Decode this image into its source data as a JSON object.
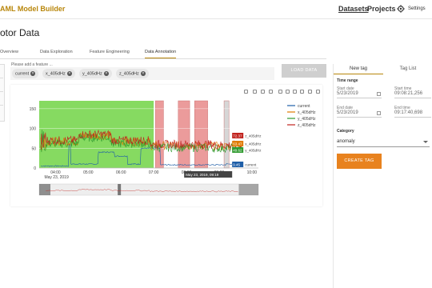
{
  "header": {
    "app_title": "AML Model Builder",
    "datasets": "Datasets",
    "projects": "Projects",
    "settings": "Settings"
  },
  "page_title": "otor Data",
  "tabs": [
    "Overview",
    "Data Exploration",
    "Feature Engineering",
    "Data Annotation"
  ],
  "active_tab": "Data Annotation",
  "feature_input": {
    "placeholder": "Please add a feature ...",
    "chips": [
      "current",
      "x_405dHz",
      "y_405dHz",
      "z_405dHz"
    ]
  },
  "load_button": "LOAD DATA",
  "right_panel": {
    "tabs": [
      "New tag",
      "Tag List"
    ],
    "time_range_label": "Time range",
    "start_date_label": "Start date",
    "start_date": "5/23/2019",
    "start_time_label": "Start time",
    "start_time": "09:08:21,256",
    "end_date_label": "End date",
    "end_date": "5/23/2019",
    "end_time_label": "End time",
    "end_time": "09:17:40,698",
    "category_label": "Category",
    "category_value": "anomaly",
    "create_button": "CREATE TAG"
  },
  "chart_data": {
    "type": "line",
    "x_ticks": [
      "04:00",
      "05:00",
      "06:00",
      "07:00",
      "08:00",
      "09:00",
      "10:00"
    ],
    "x_date_label": "May 23, 2019",
    "y_ticks": [
      0,
      50,
      100,
      150
    ],
    "ylim": [
      0,
      170
    ],
    "x_range_hours": [
      3.5,
      10.2
    ],
    "series": [
      {
        "name": "current",
        "color": "#1f5fa8"
      },
      {
        "name": "x_405dHz",
        "color": "#e07b00"
      },
      {
        "name": "y_405dHz",
        "color": "#2e9a2e"
      },
      {
        "name": "z_405dHz",
        "color": "#c0231e"
      }
    ],
    "annotations": [
      {
        "label": "normal",
        "color": "#7fd858",
        "start": 3.5,
        "end": 7.0
      },
      {
        "label": "anomaly",
        "color": "#e88a8a",
        "start": 7.05,
        "end": 7.3
      },
      {
        "label": "anomaly",
        "color": "#e88a8a",
        "start": 7.75,
        "end": 8.1
      },
      {
        "label": "anomaly",
        "color": "#e88a8a",
        "start": 8.25,
        "end": 8.65
      },
      {
        "label": "selected",
        "color": "#cfcfcf",
        "start": 9.15,
        "end": 9.3
      }
    ],
    "hover_labels": [
      {
        "text": "72.37",
        "color": "#c0231e",
        "series": "z_405dHz"
      },
      {
        "text": "63.47",
        "color": "#e07b00",
        "series": "x_405dHz"
      },
      {
        "text": "49.62",
        "color": "#2e9a2e",
        "series": "y_405dHz"
      },
      {
        "text": "9.45",
        "color": "#1f5fa8",
        "series": "current"
      }
    ],
    "hover_x_label": "May 23, 2019, 09:19",
    "legend_position": "right"
  }
}
